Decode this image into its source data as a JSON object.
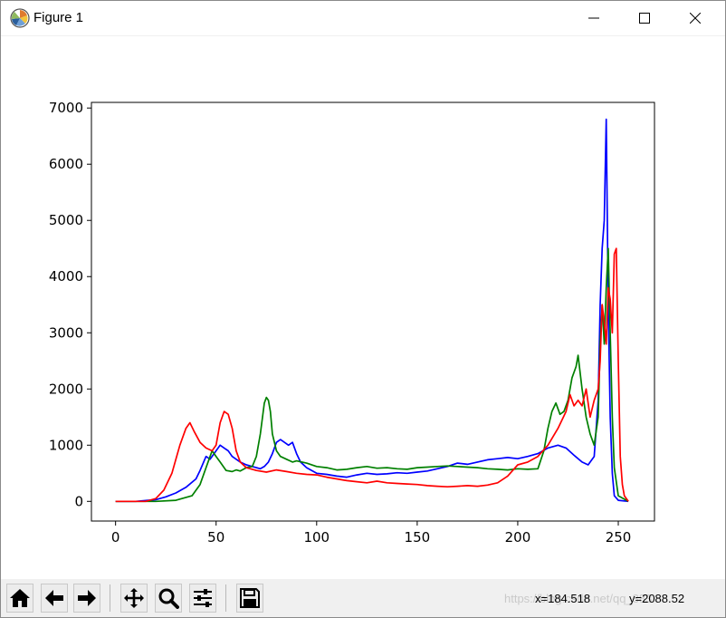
{
  "window": {
    "title": "Figure 1"
  },
  "toolbar": {
    "buttons": [
      {
        "name": "home-button",
        "icon": "home-icon"
      },
      {
        "name": "back-button",
        "icon": "arrow-left-icon"
      },
      {
        "name": "forward-button",
        "icon": "arrow-right-icon"
      },
      {
        "name": "pan-button",
        "icon": "move-icon"
      },
      {
        "name": "zoom-button",
        "icon": "magnifier-icon"
      },
      {
        "name": "subplots-button",
        "icon": "sliders-icon"
      },
      {
        "name": "save-button",
        "icon": "floppy-disk-icon"
      }
    ],
    "coord_x": "x=184.518",
    "coord_y": "y=2088.52",
    "watermark": "https://blog.csdn.net/qq_383"
  },
  "colors": {
    "blue": "#0000ff",
    "green": "#008000",
    "red": "#ff0000",
    "axis": "#000000",
    "toolbar_bg": "#f0f0f0"
  },
  "chart_data": {
    "type": "line",
    "xlim": [
      -12,
      268
    ],
    "ylim": [
      -350,
      7100
    ],
    "x_ticks": [
      0,
      50,
      100,
      150,
      200,
      250
    ],
    "y_ticks": [
      0,
      1000,
      2000,
      3000,
      4000,
      5000,
      6000,
      7000
    ],
    "grid": false,
    "series": [
      {
        "color": "#0000ff",
        "points": [
          [
            0,
            0
          ],
          [
            10,
            0
          ],
          [
            20,
            30
          ],
          [
            25,
            80
          ],
          [
            30,
            150
          ],
          [
            35,
            250
          ],
          [
            40,
            400
          ],
          [
            42,
            550
          ],
          [
            45,
            800
          ],
          [
            47,
            750
          ],
          [
            50,
            900
          ],
          [
            52,
            1000
          ],
          [
            54,
            950
          ],
          [
            56,
            900
          ],
          [
            58,
            800
          ],
          [
            60,
            750
          ],
          [
            62,
            700
          ],
          [
            65,
            650
          ],
          [
            68,
            620
          ],
          [
            70,
            600
          ],
          [
            72,
            580
          ],
          [
            74,
            620
          ],
          [
            76,
            700
          ],
          [
            78,
            850
          ],
          [
            80,
            1050
          ],
          [
            82,
            1100
          ],
          [
            84,
            1050
          ],
          [
            86,
            1000
          ],
          [
            88,
            1050
          ],
          [
            90,
            850
          ],
          [
            92,
            700
          ],
          [
            95,
            600
          ],
          [
            100,
            500
          ],
          [
            105,
            480
          ],
          [
            110,
            450
          ],
          [
            115,
            430
          ],
          [
            120,
            470
          ],
          [
            125,
            500
          ],
          [
            130,
            480
          ],
          [
            135,
            490
          ],
          [
            140,
            510
          ],
          [
            145,
            500
          ],
          [
            150,
            520
          ],
          [
            155,
            540
          ],
          [
            160,
            580
          ],
          [
            165,
            620
          ],
          [
            170,
            680
          ],
          [
            175,
            660
          ],
          [
            180,
            700
          ],
          [
            185,
            740
          ],
          [
            190,
            760
          ],
          [
            195,
            780
          ],
          [
            200,
            760
          ],
          [
            205,
            800
          ],
          [
            210,
            850
          ],
          [
            215,
            950
          ],
          [
            220,
            1000
          ],
          [
            224,
            950
          ],
          [
            228,
            820
          ],
          [
            232,
            700
          ],
          [
            235,
            650
          ],
          [
            238,
            800
          ],
          [
            240,
            1800
          ],
          [
            241,
            3500
          ],
          [
            242,
            4500
          ],
          [
            243,
            5000
          ],
          [
            244,
            6800
          ],
          [
            245,
            3500
          ],
          [
            246,
            1500
          ],
          [
            247,
            500
          ],
          [
            248,
            100
          ],
          [
            250,
            20
          ],
          [
            255,
            0
          ]
        ]
      },
      {
        "color": "#008000",
        "points": [
          [
            0,
            0
          ],
          [
            20,
            0
          ],
          [
            30,
            20
          ],
          [
            38,
            100
          ],
          [
            42,
            300
          ],
          [
            45,
            600
          ],
          [
            48,
            900
          ],
          [
            50,
            800
          ],
          [
            52,
            700
          ],
          [
            55,
            550
          ],
          [
            58,
            530
          ],
          [
            60,
            560
          ],
          [
            62,
            540
          ],
          [
            65,
            600
          ],
          [
            68,
            620
          ],
          [
            70,
            800
          ],
          [
            72,
            1200
          ],
          [
            74,
            1750
          ],
          [
            75,
            1850
          ],
          [
            76,
            1800
          ],
          [
            77,
            1600
          ],
          [
            78,
            1200
          ],
          [
            80,
            900
          ],
          [
            82,
            800
          ],
          [
            85,
            750
          ],
          [
            88,
            700
          ],
          [
            90,
            720
          ],
          [
            95,
            680
          ],
          [
            100,
            620
          ],
          [
            105,
            600
          ],
          [
            110,
            560
          ],
          [
            115,
            570
          ],
          [
            120,
            600
          ],
          [
            125,
            620
          ],
          [
            130,
            590
          ],
          [
            135,
            600
          ],
          [
            140,
            580
          ],
          [
            145,
            570
          ],
          [
            150,
            600
          ],
          [
            155,
            610
          ],
          [
            160,
            620
          ],
          [
            165,
            630
          ],
          [
            170,
            620
          ],
          [
            175,
            610
          ],
          [
            180,
            600
          ],
          [
            185,
            580
          ],
          [
            190,
            570
          ],
          [
            195,
            560
          ],
          [
            200,
            580
          ],
          [
            205,
            570
          ],
          [
            210,
            580
          ],
          [
            213,
            900
          ],
          [
            215,
            1300
          ],
          [
            217,
            1600
          ],
          [
            219,
            1750
          ],
          [
            221,
            1550
          ],
          [
            223,
            1600
          ],
          [
            225,
            1800
          ],
          [
            227,
            2200
          ],
          [
            229,
            2400
          ],
          [
            230,
            2600
          ],
          [
            232,
            2000
          ],
          [
            234,
            1500
          ],
          [
            236,
            1200
          ],
          [
            238,
            1000
          ],
          [
            240,
            1500
          ],
          [
            241,
            2800
          ],
          [
            242,
            3500
          ],
          [
            243,
            2800
          ],
          [
            244,
            3800
          ],
          [
            245,
            4500
          ],
          [
            246,
            3000
          ],
          [
            247,
            1500
          ],
          [
            248,
            600
          ],
          [
            250,
            100
          ],
          [
            255,
            0
          ]
        ]
      },
      {
        "color": "#ff0000",
        "points": [
          [
            0,
            0
          ],
          [
            15,
            0
          ],
          [
            20,
            50
          ],
          [
            24,
            200
          ],
          [
            28,
            500
          ],
          [
            32,
            1000
          ],
          [
            35,
            1300
          ],
          [
            37,
            1400
          ],
          [
            39,
            1250
          ],
          [
            42,
            1050
          ],
          [
            45,
            950
          ],
          [
            48,
            900
          ],
          [
            50,
            1000
          ],
          [
            52,
            1400
          ],
          [
            54,
            1600
          ],
          [
            56,
            1550
          ],
          [
            58,
            1300
          ],
          [
            60,
            900
          ],
          [
            62,
            700
          ],
          [
            65,
            600
          ],
          [
            70,
            550
          ],
          [
            75,
            520
          ],
          [
            80,
            560
          ],
          [
            85,
            530
          ],
          [
            90,
            500
          ],
          [
            95,
            480
          ],
          [
            100,
            470
          ],
          [
            105,
            430
          ],
          [
            110,
            400
          ],
          [
            115,
            370
          ],
          [
            120,
            350
          ],
          [
            125,
            330
          ],
          [
            130,
            360
          ],
          [
            135,
            330
          ],
          [
            140,
            320
          ],
          [
            145,
            310
          ],
          [
            150,
            300
          ],
          [
            155,
            280
          ],
          [
            160,
            270
          ],
          [
            165,
            260
          ],
          [
            170,
            270
          ],
          [
            175,
            280
          ],
          [
            180,
            270
          ],
          [
            185,
            290
          ],
          [
            190,
            330
          ],
          [
            195,
            450
          ],
          [
            200,
            650
          ],
          [
            205,
            700
          ],
          [
            210,
            800
          ],
          [
            215,
            1000
          ],
          [
            220,
            1300
          ],
          [
            224,
            1600
          ],
          [
            226,
            1900
          ],
          [
            228,
            1700
          ],
          [
            230,
            1800
          ],
          [
            232,
            1700
          ],
          [
            234,
            2000
          ],
          [
            236,
            1500
          ],
          [
            238,
            1800
          ],
          [
            240,
            2000
          ],
          [
            241,
            2500
          ],
          [
            242,
            3500
          ],
          [
            243,
            3200
          ],
          [
            244,
            2800
          ],
          [
            245,
            3800
          ],
          [
            246,
            3600
          ],
          [
            247,
            3000
          ],
          [
            248,
            4400
          ],
          [
            249,
            4500
          ],
          [
            250,
            2500
          ],
          [
            251,
            800
          ],
          [
            252,
            300
          ],
          [
            253,
            100
          ],
          [
            255,
            0
          ]
        ]
      }
    ]
  }
}
